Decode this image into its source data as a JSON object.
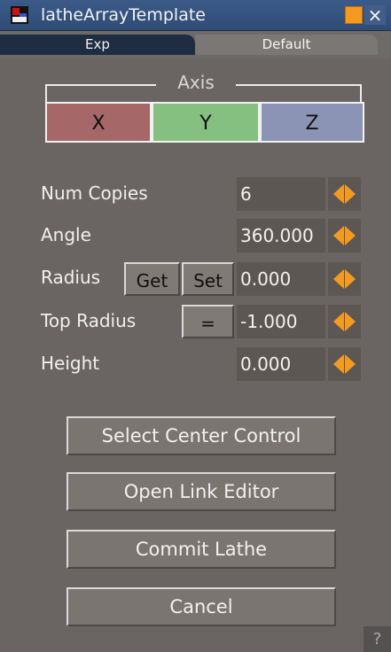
{
  "window": {
    "title": "latheArrayTemplate",
    "close_glyph": "×"
  },
  "tabs": [
    {
      "label": "Exp",
      "active": true
    },
    {
      "label": "Default",
      "active": false
    }
  ],
  "axis": {
    "label": "Axis",
    "buttons": [
      {
        "label": "X",
        "color": "#a56767"
      },
      {
        "label": "Y",
        "color": "#86c081"
      },
      {
        "label": "Z",
        "color": "#8b94b4"
      }
    ]
  },
  "params": {
    "num_copies": {
      "label": "Num Copies",
      "value": "6"
    },
    "angle": {
      "label": "Angle",
      "value": "360.000"
    },
    "radius": {
      "label": "Radius",
      "value": "0.000",
      "get_label": "Get",
      "set_label": "Set"
    },
    "top_radius": {
      "label": "Top Radius",
      "value": "-1.000",
      "equals_label": "="
    },
    "height": {
      "label": "Height",
      "value": "0.000"
    }
  },
  "actions": {
    "select_center": "Select Center Control",
    "open_link_editor": "Open Link Editor",
    "commit_lathe": "Commit Lathe",
    "cancel": "Cancel"
  },
  "help": "?",
  "colors": {
    "spinner_accent": "#f39a21",
    "background": "#6a6562"
  },
  "icons": {
    "app": "lathe-app-icon",
    "minimize": "minimize-icon",
    "close": "close-icon",
    "spinner": "spinner-arrows-icon"
  }
}
